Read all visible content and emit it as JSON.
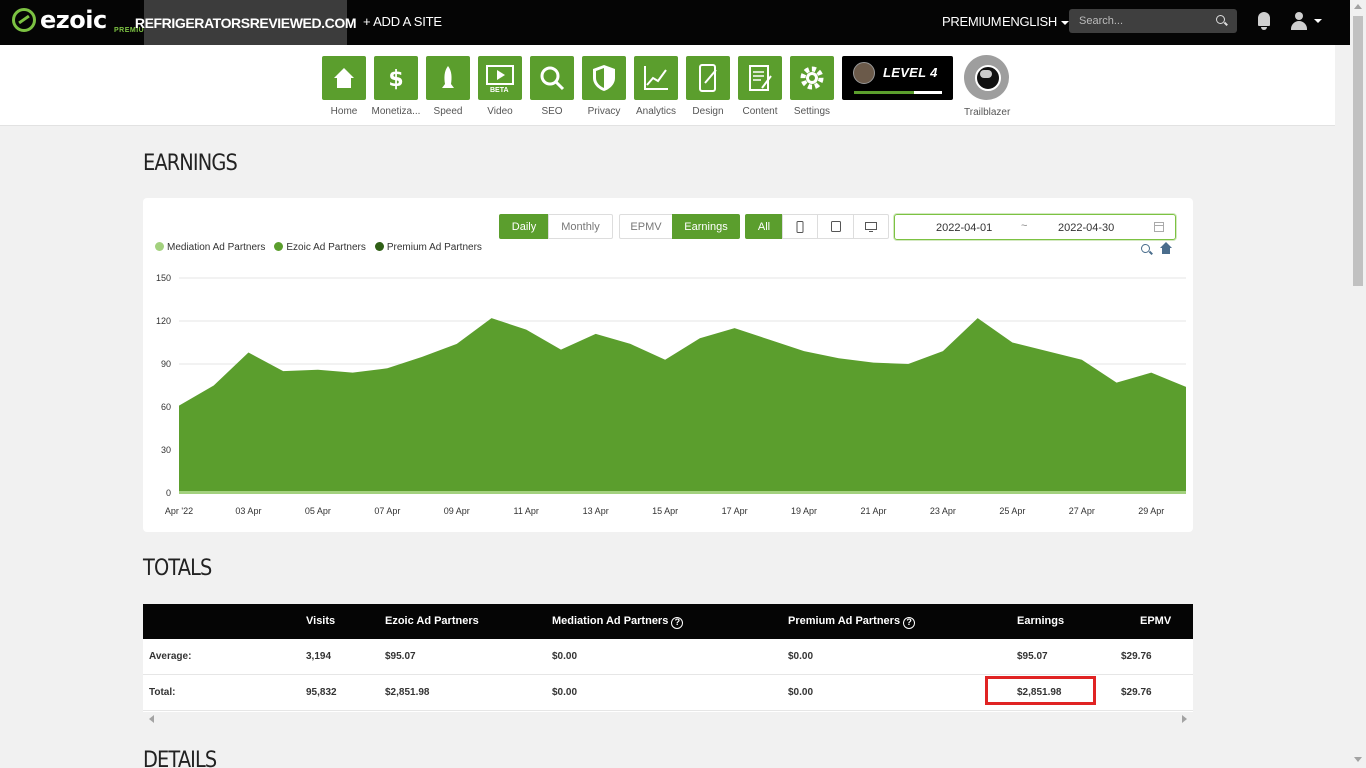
{
  "topbar": {
    "logo": "ezoic",
    "logo_sub": "PREMIUM",
    "site": "REFRIGERATORSREVIEWED.COM",
    "add_site": "+ ADD A SITE",
    "premium": "PREMIUM",
    "language": "ENGLISH",
    "search_placeholder": "Search..."
  },
  "nav": {
    "items": [
      {
        "label": "Home",
        "icon": "home-icon"
      },
      {
        "label": "Monetiza...",
        "icon": "dollar-icon"
      },
      {
        "label": "Speed",
        "icon": "rocket-icon"
      },
      {
        "label": "Video",
        "icon": "video-icon",
        "badge": "BETA"
      },
      {
        "label": "SEO",
        "icon": "magnifier-icon"
      },
      {
        "label": "Privacy",
        "icon": "shield-icon"
      },
      {
        "label": "Analytics",
        "icon": "line-chart-icon"
      },
      {
        "label": "Design",
        "icon": "mobile-edit-icon"
      },
      {
        "label": "Content",
        "icon": "document-edit-icon"
      },
      {
        "label": "Settings",
        "icon": "gear-icon"
      }
    ],
    "level": {
      "text": "LEVEL 4",
      "progress": 0.68
    },
    "trailblazer": "Trailblazer"
  },
  "earnings": {
    "heading": "EARNINGS",
    "buttons": {
      "daily": "Daily",
      "monthly": "Monthly",
      "epmv": "EPMV",
      "earnings": "Earnings",
      "all": "All"
    },
    "date_from": "2022-04-01",
    "date_sep": "~",
    "date_to": "2022-04-30",
    "legend": [
      {
        "name": "Mediation Ad Partners",
        "color": "#a3d17e"
      },
      {
        "name": "Ezoic Ad Partners",
        "color": "#5b9e2d"
      },
      {
        "name": "Premium Ad Partners",
        "color": "#2f5f16"
      }
    ]
  },
  "chart_data": {
    "type": "area",
    "x": [
      "2022-04-01",
      "2022-04-02",
      "2022-04-03",
      "2022-04-04",
      "2022-04-05",
      "2022-04-06",
      "2022-04-07",
      "2022-04-08",
      "2022-04-09",
      "2022-04-10",
      "2022-04-11",
      "2022-04-12",
      "2022-04-13",
      "2022-04-14",
      "2022-04-15",
      "2022-04-16",
      "2022-04-17",
      "2022-04-18",
      "2022-04-19",
      "2022-04-20",
      "2022-04-21",
      "2022-04-22",
      "2022-04-23",
      "2022-04-24",
      "2022-04-25",
      "2022-04-26",
      "2022-04-27",
      "2022-04-28",
      "2022-04-29",
      "2022-04-30"
    ],
    "series": [
      {
        "name": "Ezoic Ad Partners",
        "color": "#5b9e2d",
        "values": [
          61,
          75,
          98,
          85,
          86,
          84,
          87,
          95,
          104,
          122,
          114,
          100,
          111,
          104,
          93,
          108,
          115,
          107,
          99,
          94,
          91,
          90,
          99,
          122,
          105,
          99,
          93,
          77,
          84,
          74
        ]
      },
      {
        "name": "Mediation Ad Partners",
        "color": "#a3d17e",
        "values": [
          0,
          0,
          0,
          0,
          0,
          0,
          0,
          0,
          0,
          0,
          0,
          0,
          0,
          0,
          0,
          0,
          0,
          0,
          0,
          0,
          0,
          0,
          0,
          0,
          0,
          0,
          0,
          0,
          0,
          0
        ]
      }
    ],
    "y_ticks": [
      "0",
      "30",
      "60",
      "90",
      "120",
      "150"
    ],
    "x_tick_labels": [
      "Apr '22",
      "03 Apr",
      "05 Apr",
      "07 Apr",
      "09 Apr",
      "11 Apr",
      "13 Apr",
      "15 Apr",
      "17 Apr",
      "19 Apr",
      "21 Apr",
      "23 Apr",
      "25 Apr",
      "27 Apr",
      "29 Apr"
    ],
    "ylim": [
      0,
      150
    ],
    "grid": true,
    "legend_position": "top-left"
  },
  "totals": {
    "heading": "TOTALS",
    "columns": [
      "Visits",
      "Ezoic Ad Partners",
      "Mediation Ad Partners",
      "Premium Ad Partners",
      "Earnings",
      "EPMV"
    ],
    "rows": [
      {
        "label": "Average:",
        "values": [
          "3,194",
          "$95.07",
          "$0.00",
          "$0.00",
          "$95.07",
          "$29.76"
        ]
      },
      {
        "label": "Total:",
        "values": [
          "95,832",
          "$2,851.98",
          "$0.00",
          "$0.00",
          "$2,851.98",
          "$29.76"
        ]
      }
    ]
  },
  "details": {
    "heading": "DETAILS"
  }
}
